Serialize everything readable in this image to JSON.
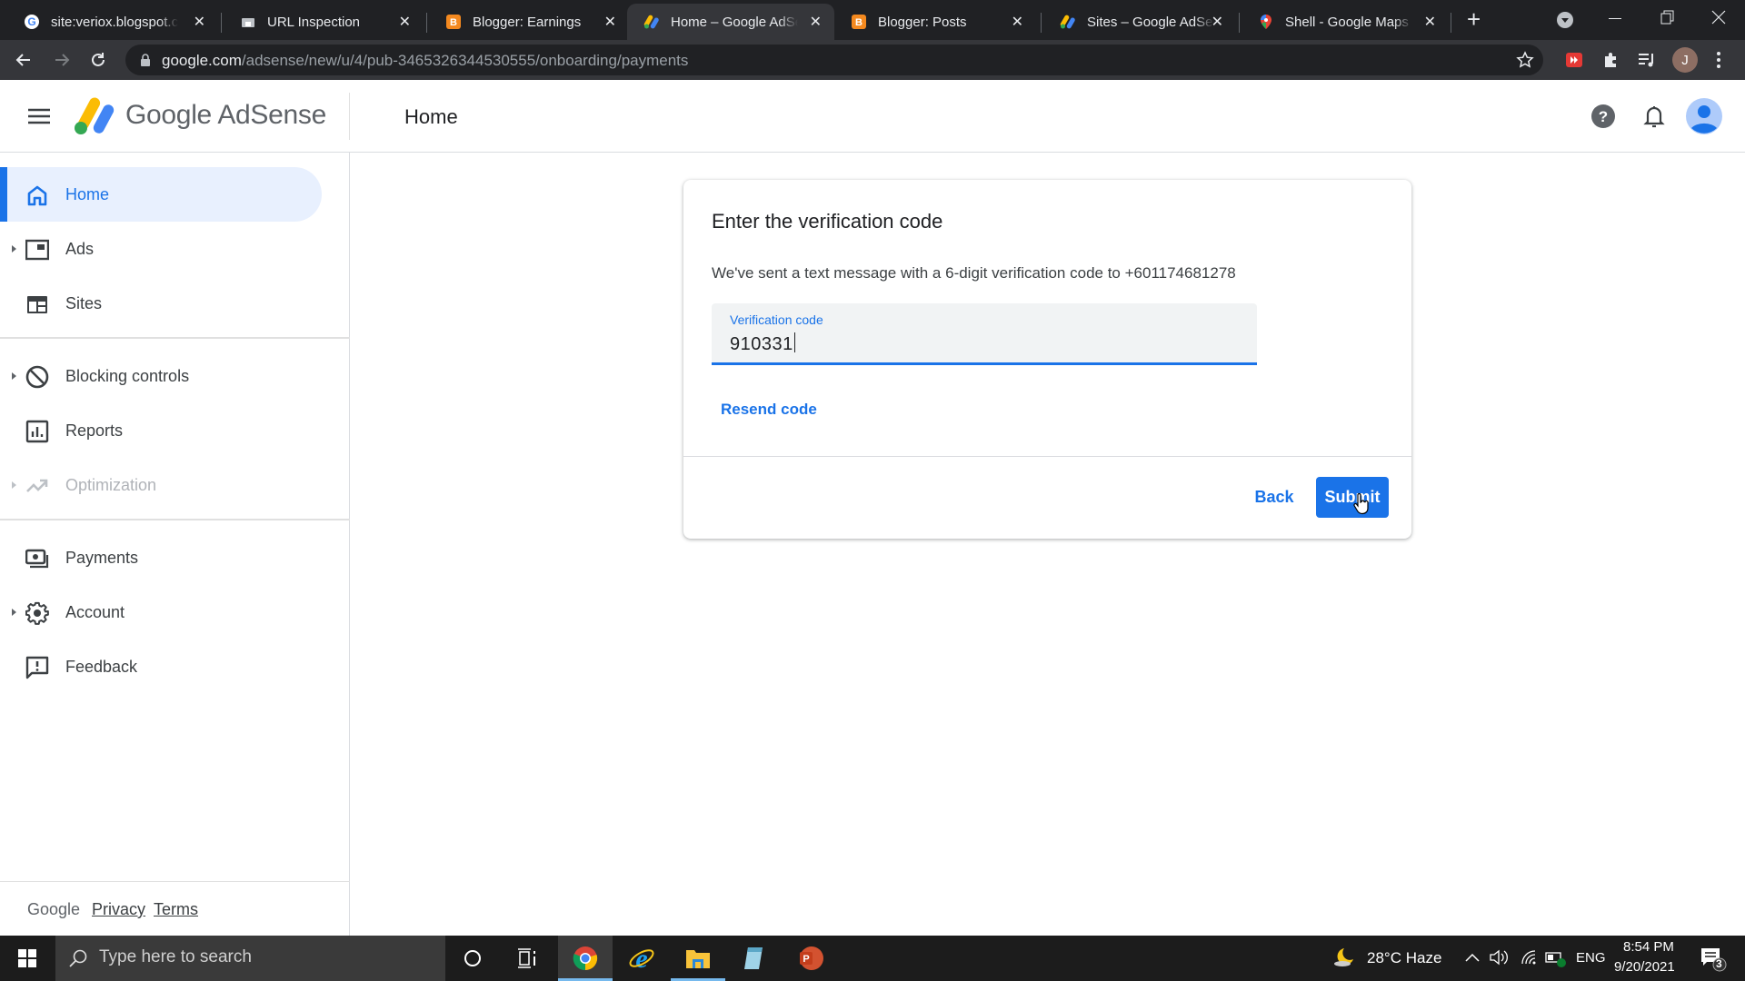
{
  "browser": {
    "tabs": [
      {
        "title": "site:veriox.blogspot.co",
        "icon": "google-g-icon",
        "active": false
      },
      {
        "title": "URL Inspection",
        "icon": "search-console-icon",
        "active": false
      },
      {
        "title": "Blogger: Earnings",
        "icon": "blogger-icon",
        "active": false
      },
      {
        "title": "Home – Google AdSense",
        "icon": "adsense-icon",
        "active": true
      },
      {
        "title": "Blogger: Posts",
        "icon": "blogger-icon",
        "active": false
      },
      {
        "title": "Sites – Google AdSense",
        "icon": "adsense-icon",
        "active": false
      },
      {
        "title": "Shell - Google Maps",
        "icon": "maps-pin-icon",
        "active": false
      }
    ],
    "close_glyph": "✕",
    "new_tab_glyph": "+",
    "url_host": "google.com",
    "url_path": "/adsense/new/u/4/pub-3465326344530555/onboarding/payments",
    "profile_initial": "J"
  },
  "app": {
    "brand": "Google AdSense",
    "page_title": "Home"
  },
  "sidebar": {
    "items": [
      {
        "label": "Home",
        "icon": "home-icon",
        "active": true,
        "expandable": false,
        "disabled": false
      },
      {
        "label": "Ads",
        "icon": "ads-icon",
        "active": false,
        "expandable": true,
        "disabled": false
      },
      {
        "label": "Sites",
        "icon": "sites-icon",
        "active": false,
        "expandable": false,
        "disabled": false
      },
      {
        "label": "Blocking controls",
        "icon": "block-icon",
        "active": false,
        "expandable": true,
        "disabled": false
      },
      {
        "label": "Reports",
        "icon": "reports-icon",
        "active": false,
        "expandable": false,
        "disabled": false
      },
      {
        "label": "Optimization",
        "icon": "trending-up-icon",
        "active": false,
        "expandable": true,
        "disabled": true
      },
      {
        "label": "Payments",
        "icon": "payments-icon",
        "active": false,
        "expandable": false,
        "disabled": false
      },
      {
        "label": "Account",
        "icon": "gear-icon",
        "active": false,
        "expandable": true,
        "disabled": false
      },
      {
        "label": "Feedback",
        "icon": "feedback-icon",
        "active": false,
        "expandable": false,
        "disabled": false
      }
    ],
    "footer": {
      "google": "Google",
      "privacy": "Privacy",
      "terms": "Terms"
    }
  },
  "dialog": {
    "title": "Enter the verification code",
    "description": "We've sent a text message with a 6-digit verification code to +601174681278",
    "field_label": "Verification code",
    "field_value": "910331",
    "resend_label": "Resend code",
    "back_label": "Back",
    "submit_label": "Submit"
  },
  "taskbar": {
    "search_placeholder": "Type here to search",
    "weather": "28°C  Haze",
    "language": "ENG",
    "time": "8:54 PM",
    "date": "9/20/2021",
    "notification_count": "3"
  },
  "colors": {
    "accent": "#1a73e8",
    "active_nav_bg": "#e8f0fe",
    "chrome_dark": "#202124"
  }
}
